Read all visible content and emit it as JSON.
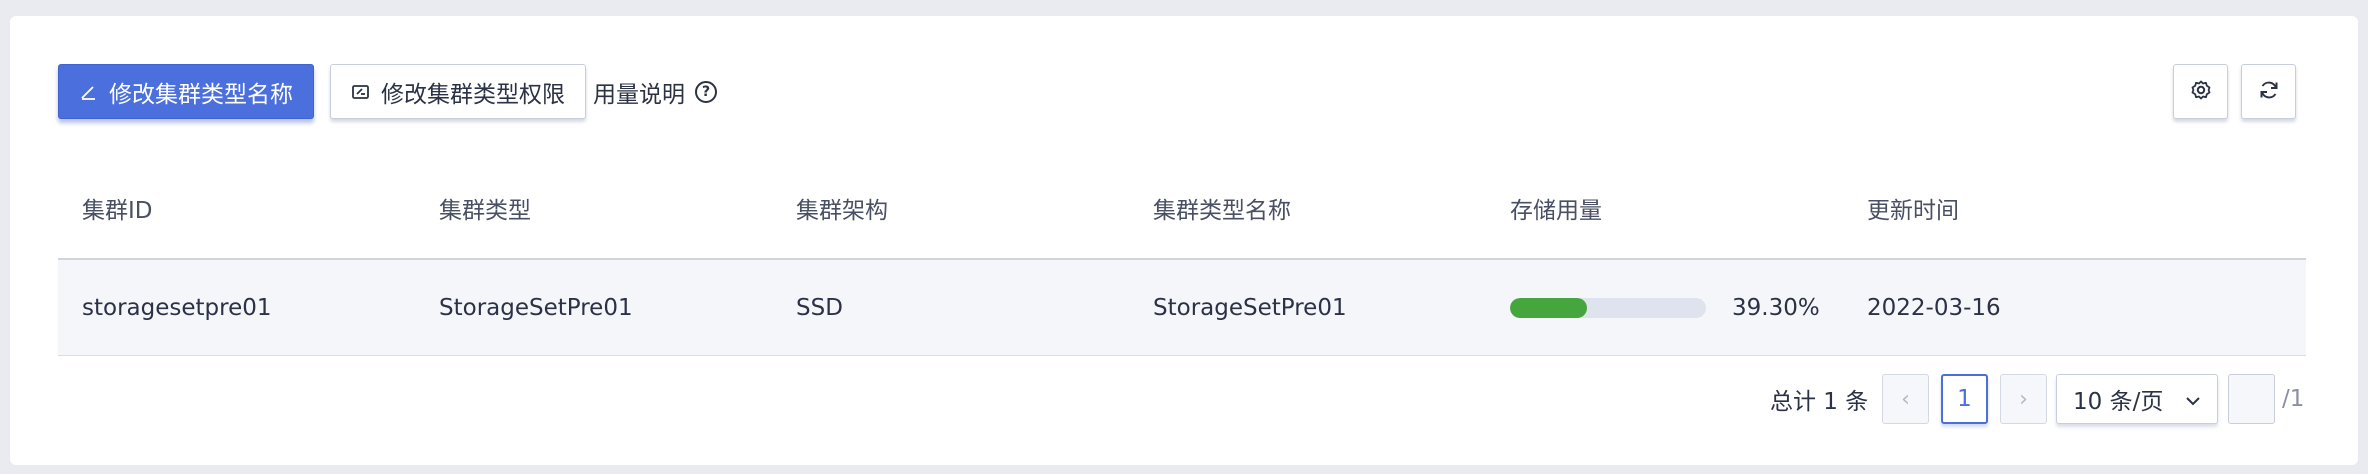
{
  "toolbar": {
    "rename_label": "修改集群类型名称",
    "permission_label": "修改集群类型权限",
    "usage_help_label": "用量说明",
    "help_glyph": "?"
  },
  "table": {
    "columns": [
      "集群ID",
      "集群类型",
      "集群架构",
      "集群类型名称",
      "存储用量",
      "更新时间"
    ],
    "rows": [
      {
        "cluster_id": "storagesetpre01",
        "cluster_type": "StorageSetPre01",
        "architecture": "SSD",
        "type_name": "StorageSetPre01",
        "storage_usage": "39.30%",
        "storage_usage_fraction": 0.393,
        "updated": "2022-03-16"
      }
    ]
  },
  "pagination": {
    "total": "总计 1 条",
    "prev": "‹",
    "current_page": "1",
    "next": "›",
    "page_size": "10 条/页",
    "jump_value": "",
    "total_pages": "/1"
  },
  "colors": {
    "primary": "#4b6fdd",
    "progress": "#45a63d",
    "track": "#dfe3ee"
  },
  "icons": {
    "rename": "edit-pen-icon",
    "permission": "edit-permission-icon",
    "help": "question-circle-icon",
    "settings": "gear-icon",
    "refresh": "refresh-icon",
    "size_dropdown": "chevron-down-icon"
  }
}
